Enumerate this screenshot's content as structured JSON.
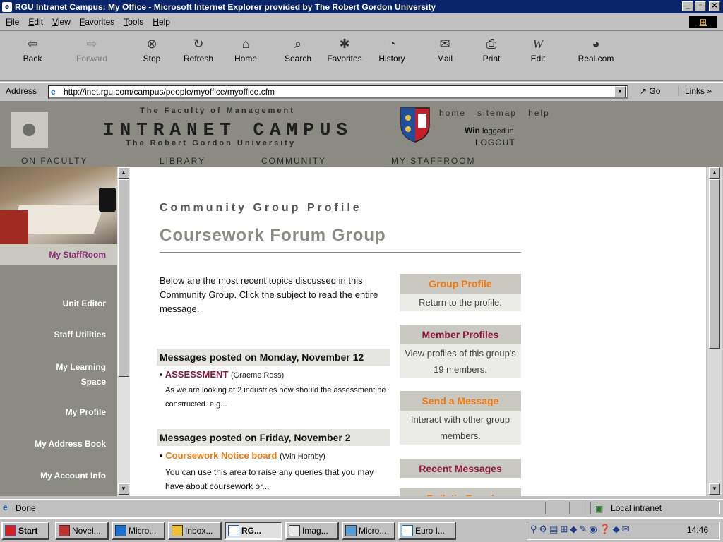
{
  "window": {
    "title": "RGU Intranet Campus: My Office - Microsoft Internet Explorer provided by The Robert Gordon University"
  },
  "menu": [
    "File",
    "Edit",
    "View",
    "Favorites",
    "Tools",
    "Help"
  ],
  "toolbar": [
    {
      "label": "Back",
      "icon": "back-arrow",
      "enabled": true
    },
    {
      "label": "Forward",
      "icon": "forward-arrow",
      "enabled": false
    },
    {
      "label": "Stop",
      "icon": "stop",
      "enabled": true
    },
    {
      "label": "Refresh",
      "icon": "refresh",
      "enabled": true
    },
    {
      "label": "Home",
      "icon": "home",
      "enabled": true
    },
    {
      "label": "Search",
      "icon": "search",
      "enabled": true
    },
    {
      "label": "Favorites",
      "icon": "favorites",
      "enabled": true
    },
    {
      "label": "History",
      "icon": "history",
      "enabled": true
    },
    {
      "label": "Mail",
      "icon": "mail",
      "enabled": true
    },
    {
      "label": "Print",
      "icon": "print",
      "enabled": true
    },
    {
      "label": "Edit",
      "icon": "edit",
      "enabled": true
    },
    {
      "label": "Real.com",
      "icon": "realcom",
      "enabled": true
    }
  ],
  "address": {
    "label": "Address",
    "url": "http://inet.rgu.com/campus/people/myoffice/myoffice.cfm",
    "go": "Go",
    "links": "Links"
  },
  "site": {
    "faculty": "The Faculty of Management",
    "title": "INTRANET CAMPUS",
    "university": "The Robert Gordon University",
    "top_links": [
      "home",
      "sitemap",
      "help"
    ],
    "user_name": "Win",
    "logged_in": "logged in",
    "logout": "LOGOUT",
    "nav": [
      "ON FACULTY",
      "LIBRARY",
      "COMMUNITY",
      "MY STAFFROOM"
    ]
  },
  "sidebar": {
    "active": "My StaffRoom",
    "items": [
      "Unit Editor",
      "Staff Utilities",
      "My Learning Space",
      "My Profile",
      "My Address Book",
      "My Account Info"
    ]
  },
  "main": {
    "heading": "Community Group Profile",
    "group_name": "Coursework Forum Group",
    "intro": "Below are the most recent topics discussed in this Community Group. Click the subject to read the entire message.",
    "sections": [
      {
        "header": "Messages posted on Monday, November 12",
        "title": "ASSESSMENT",
        "author": "(Graeme Ross)",
        "excerpt": "As we are looking at 2 industries how should the assessment be constructed. e.g..."
      },
      {
        "header": "Messages posted on Friday, November 2",
        "title": "Coursework Notice board",
        "author": "(Win Hornby)",
        "excerpt": "You can use this area to raise any queries that you may have about coursework or..."
      }
    ],
    "boxes": [
      {
        "title": "Group Profile",
        "desc": "Return to the profile."
      },
      {
        "title": "Member Profiles",
        "desc": "View profiles of this group's 19 members."
      },
      {
        "title": "Send a Message",
        "desc": "Interact with other group members."
      },
      {
        "title": "Recent Messages",
        "desc": ""
      },
      {
        "title": "Bulletin Board",
        "desc": ""
      }
    ]
  },
  "status": {
    "text": "Done",
    "zone": "Local intranet"
  },
  "taskbar": {
    "start": "Start",
    "tasks": [
      "Novel...",
      "Micro...",
      "Inbox...",
      "RG...",
      "Imag...",
      "Micro...",
      "Euro I..."
    ],
    "active_task": "RG...",
    "clock": "14:46"
  },
  "colors": {
    "title_bg": "#0a246a",
    "header_gray": "#8b8b83",
    "accent_orange": "#f07a10",
    "accent_maroon": "#8b1a3a",
    "sidebar_active": "#8b2b74"
  }
}
